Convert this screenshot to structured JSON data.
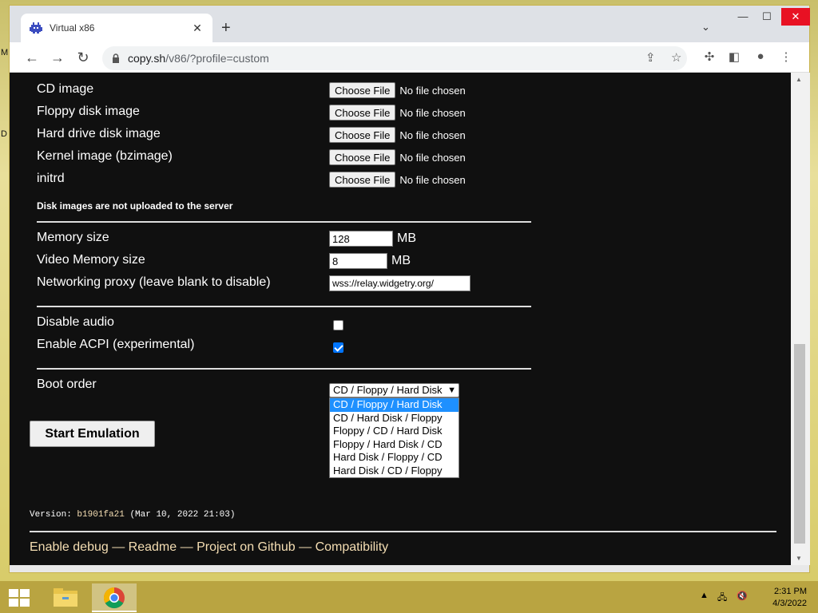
{
  "desktop": {
    "label_m": "M",
    "label_d": "D"
  },
  "browser": {
    "tab_title": "Virtual x86",
    "url_host": "copy.sh",
    "url_path": "/v86/?profile=custom",
    "new_tab": "+",
    "tab_close": "✕",
    "tab_search": "⌄",
    "min": "—",
    "max": "☐",
    "close": "✕"
  },
  "files": [
    {
      "label": "CD image",
      "button": "Choose File",
      "status": "No file chosen"
    },
    {
      "label": "Floppy disk image",
      "button": "Choose File",
      "status": "No file chosen"
    },
    {
      "label": "Hard drive disk image",
      "button": "Choose File",
      "status": "No file chosen"
    },
    {
      "label": "Kernel image (bzimage)",
      "button": "Choose File",
      "status": "No file chosen"
    },
    {
      "label": "initrd",
      "button": "Choose File",
      "status": "No file chosen"
    }
  ],
  "upload_note": "Disk images are not uploaded to the server",
  "settings": {
    "memory_label": "Memory size",
    "memory_value": "128",
    "memory_unit": "MB",
    "video_label": "Video Memory size",
    "video_value": "8",
    "video_unit": "MB",
    "proxy_label": "Networking proxy (leave blank to disable)",
    "proxy_value": "wss://relay.widgetry.org/"
  },
  "options": {
    "audio_label": "Disable audio",
    "audio_checked": false,
    "acpi_label": "Enable ACPI (experimental)",
    "acpi_checked": true
  },
  "boot": {
    "label": "Boot order",
    "selected": "CD / Floppy / Hard Disk",
    "choices": [
      "CD / Floppy / Hard Disk",
      "CD / Hard Disk / Floppy",
      "Floppy / CD / Hard Disk",
      "Floppy / Hard Disk / CD",
      "Hard Disk / Floppy / CD",
      "Hard Disk / CD / Floppy"
    ]
  },
  "start_button": "Start Emulation",
  "version": {
    "prefix": "Version:",
    "hash": "b1901fa21",
    "date": "(Mar 10, 2022 21:03)"
  },
  "footer": {
    "debug": "Enable debug",
    "readme": "Readme",
    "github": "Project on Github",
    "compat": "Compatibility",
    "sep": "—"
  },
  "taskbar": {
    "time": "2:31 PM",
    "date": "4/3/2022"
  },
  "colors": {
    "page_bg": "#101010",
    "link": "#f5deb3",
    "accent_blue": "#1e90ff",
    "titlebar_close": "#e81123"
  }
}
